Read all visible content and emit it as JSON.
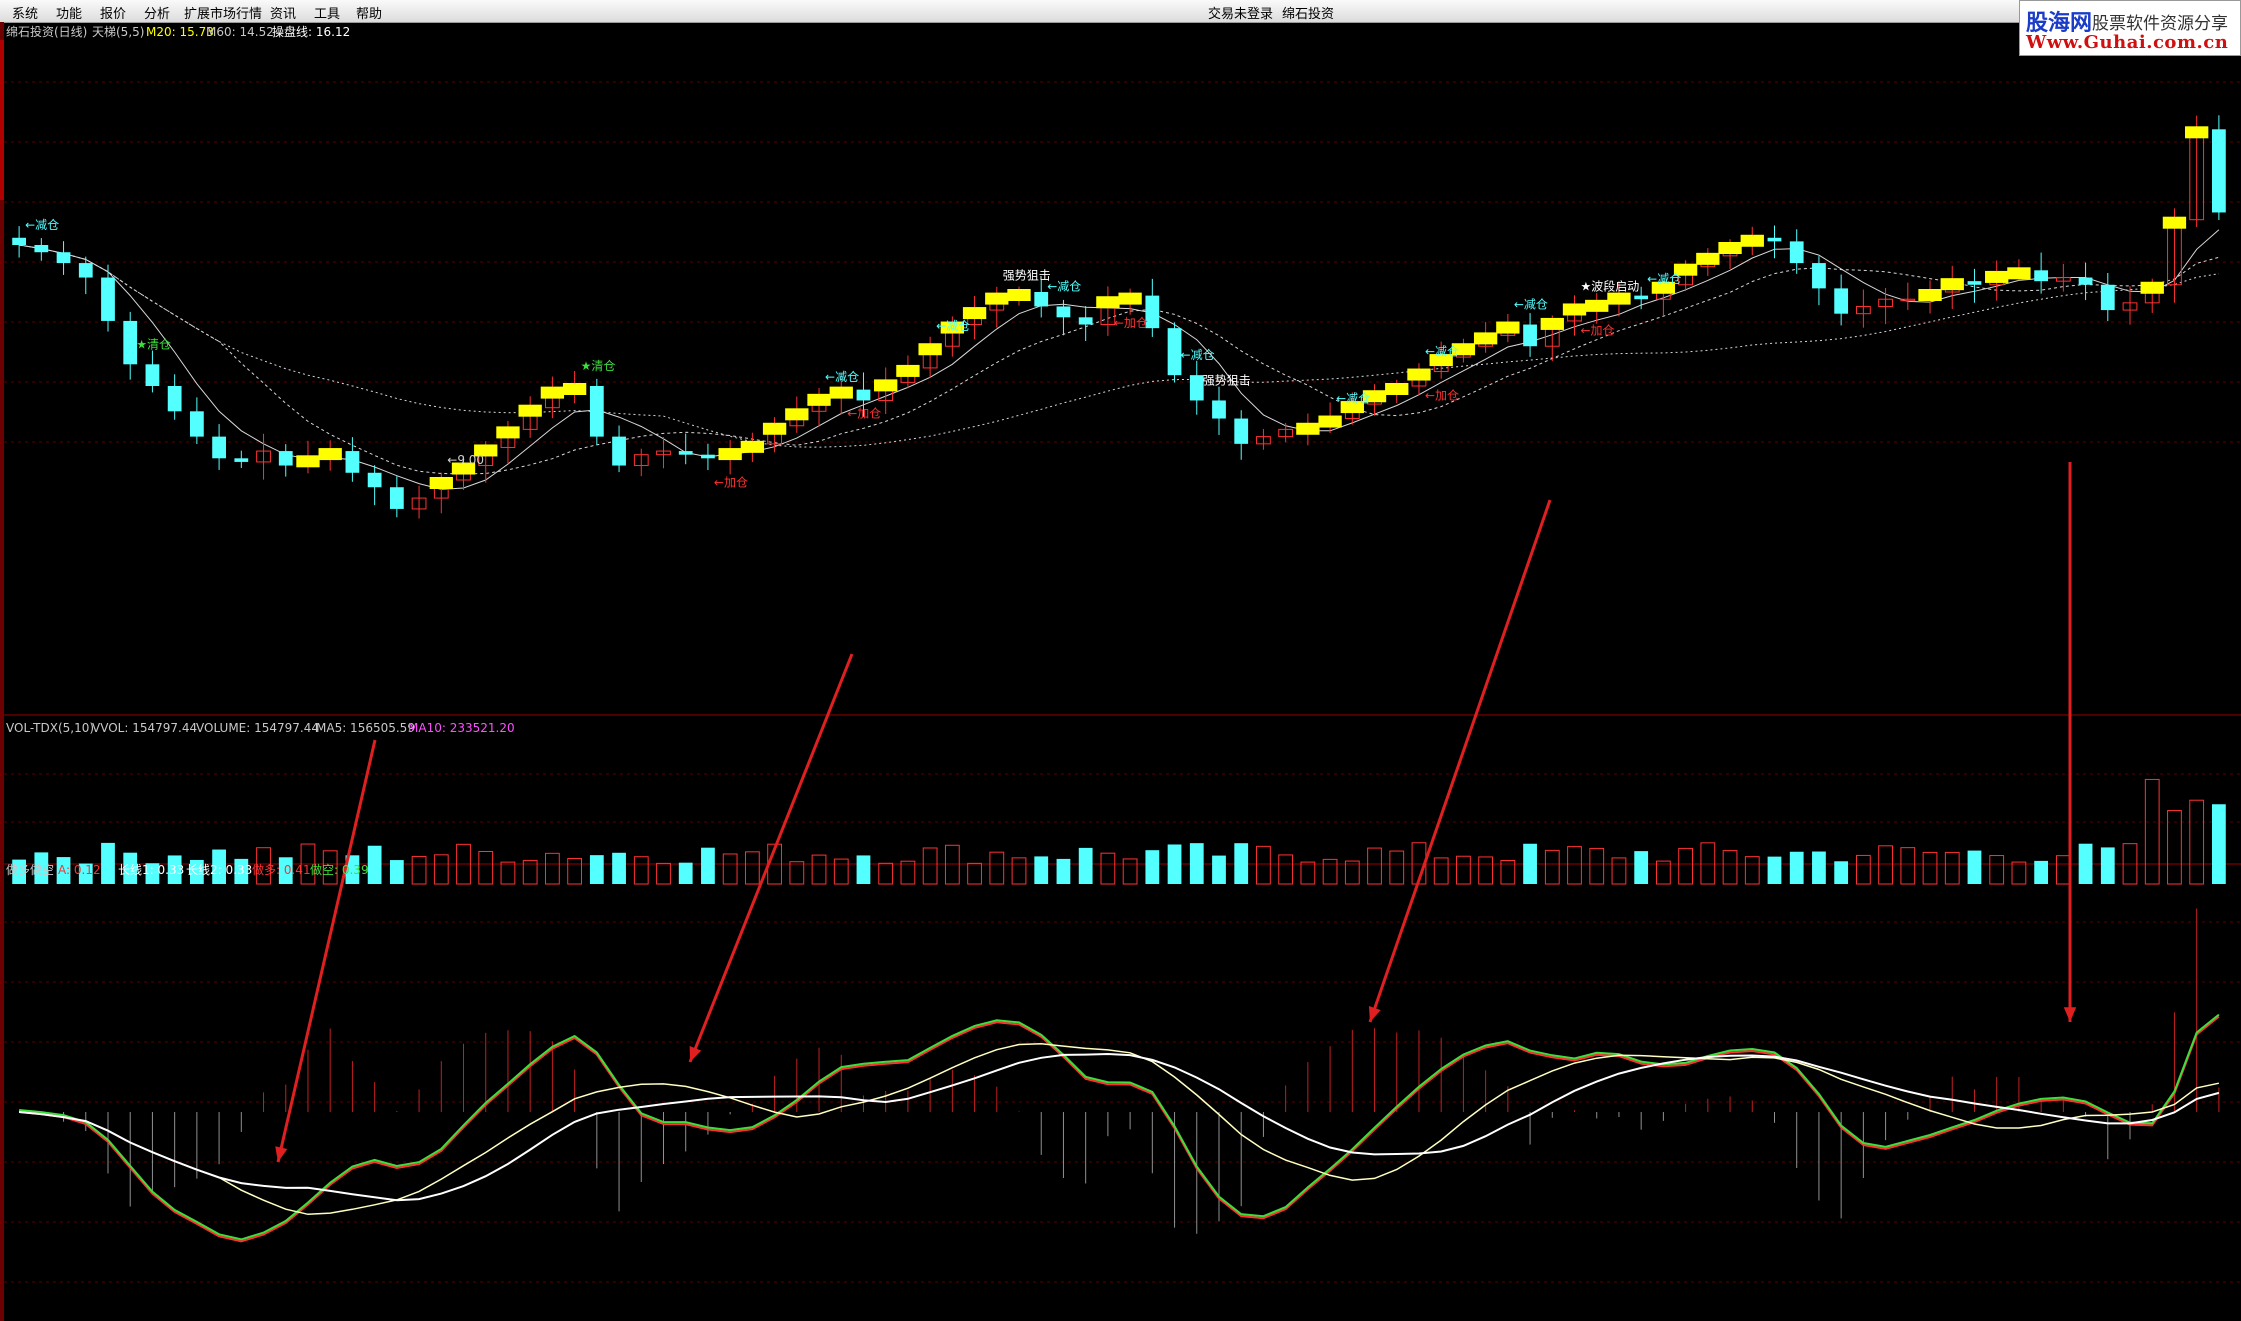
{
  "menu": {
    "items": [
      "系统",
      "功能",
      "报价",
      "分析",
      "扩展市场行情",
      "资讯",
      "工具",
      "帮助"
    ],
    "center": [
      "交易未登录",
      "绵石投资"
    ]
  },
  "logo": {
    "main": "股海网",
    "slogan": "股票软件资源分享",
    "url": "Www.Guhai.com.cn"
  },
  "colors": {
    "up": "#ff3232",
    "down": "#54ffff",
    "signal_yellow": "#ffff00",
    "grid": "#5a0000",
    "green": "#3ce03c",
    "white": "#ffffff",
    "magenta": "#ff50ff"
  },
  "main_panel": {
    "header": {
      "title": "绵石投资(日线)",
      "indicator": "天梯(5,5)",
      "m20": "M20: 15.73",
      "m60": "M60: 14.52",
      "pan": "操盘线: 16.12"
    },
    "labels": [
      {
        "text": "←减仓",
        "color": "#54ffff"
      },
      {
        "text": "★清仓",
        "color": "#3ce03c"
      },
      {
        "text": "←9.00",
        "color": "#d0d0d0"
      },
      {
        "text": "★清仓",
        "color": "#3ce03c"
      },
      {
        "text": "←加仓",
        "color": "#ff3232"
      },
      {
        "text": "←减仓",
        "color": "#54ffff"
      },
      {
        "text": "←加仓",
        "color": "#ff3232"
      },
      {
        "text": "←减仓",
        "color": "#54ffff"
      },
      {
        "text": "强势狙击",
        "color": "#ffffff"
      },
      {
        "text": "←减仓",
        "color": "#54ffff"
      },
      {
        "text": "←加仓",
        "color": "#ff3232"
      },
      {
        "text": "←减仓",
        "color": "#54ffff"
      },
      {
        "text": "强势狙击",
        "color": "#ffffff"
      },
      {
        "text": "←减仓",
        "color": "#54ffff"
      },
      {
        "text": "←加仓",
        "color": "#ff3232"
      },
      {
        "text": "←减仓",
        "color": "#54ffff"
      },
      {
        "text": "←减仓",
        "color": "#54ffff"
      },
      {
        "text": "★波段启动",
        "color": "#ffffff"
      },
      {
        "text": "←加仓",
        "color": "#ff3232"
      },
      {
        "text": "←减仓",
        "color": "#54ffff"
      }
    ]
  },
  "vol_panel": {
    "header": {
      "title": "VOL-TDX(5,10)",
      "vvol": "VVOL: 154797.44",
      "volume": "VOLUME: 154797.44",
      "ma5": "MA5: 156505.59",
      "ma10": "MA10: 233521.20"
    }
  },
  "osc_panel": {
    "header": {
      "title": "做多做空",
      "a": "A: 0.12",
      "long1": "长线1: 0.33",
      "long2": "长线2: 0.33",
      "bull": "做多: 0.41",
      "bear": "做空: 0.39"
    }
  },
  "chart_data": {
    "type": "candlestick",
    "x_count": 100,
    "close_approx": [
      16.3,
      16.1,
      15.8,
      15.4,
      14.2,
      13.0,
      12.4,
      11.7,
      11.0,
      10.4,
      10.3,
      10.6,
      10.2,
      10.4,
      10.6,
      10.0,
      9.6,
      9.0,
      9.3,
      9.8,
      10.2,
      10.7,
      11.2,
      11.8,
      12.3,
      12.4,
      11.0,
      10.2,
      10.5,
      10.6,
      10.5,
      10.4,
      10.6,
      10.8,
      11.3,
      11.7,
      12.1,
      12.3,
      12.0,
      12.5,
      12.9,
      13.5,
      14.1,
      14.5,
      14.9,
      15.0,
      14.6,
      14.3,
      14.1,
      14.8,
      14.9,
      14.0,
      12.7,
      12.0,
      11.5,
      10.8,
      11.0,
      11.2,
      11.3,
      11.5,
      11.9,
      12.2,
      12.4,
      12.8,
      13.2,
      13.5,
      13.8,
      14.1,
      13.5,
      14.2,
      14.6,
      14.7,
      14.9,
      14.8,
      15.2,
      15.7,
      16.0,
      16.3,
      16.5,
      16.4,
      15.8,
      15.1,
      14.4,
      14.6,
      14.8,
      14.8,
      15.0,
      15.3,
      15.2,
      15.5,
      15.6,
      15.3,
      15.4,
      15.2,
      14.5,
      14.7,
      15.2,
      17.0,
      19.5,
      17.2
    ],
    "annotations": [
      "←减仓",
      "★清仓",
      "★清仓",
      "←加仓",
      "强势狙击",
      "★波段启动"
    ],
    "ma_lines": [
      "M20",
      "M60",
      "操盘线"
    ]
  }
}
